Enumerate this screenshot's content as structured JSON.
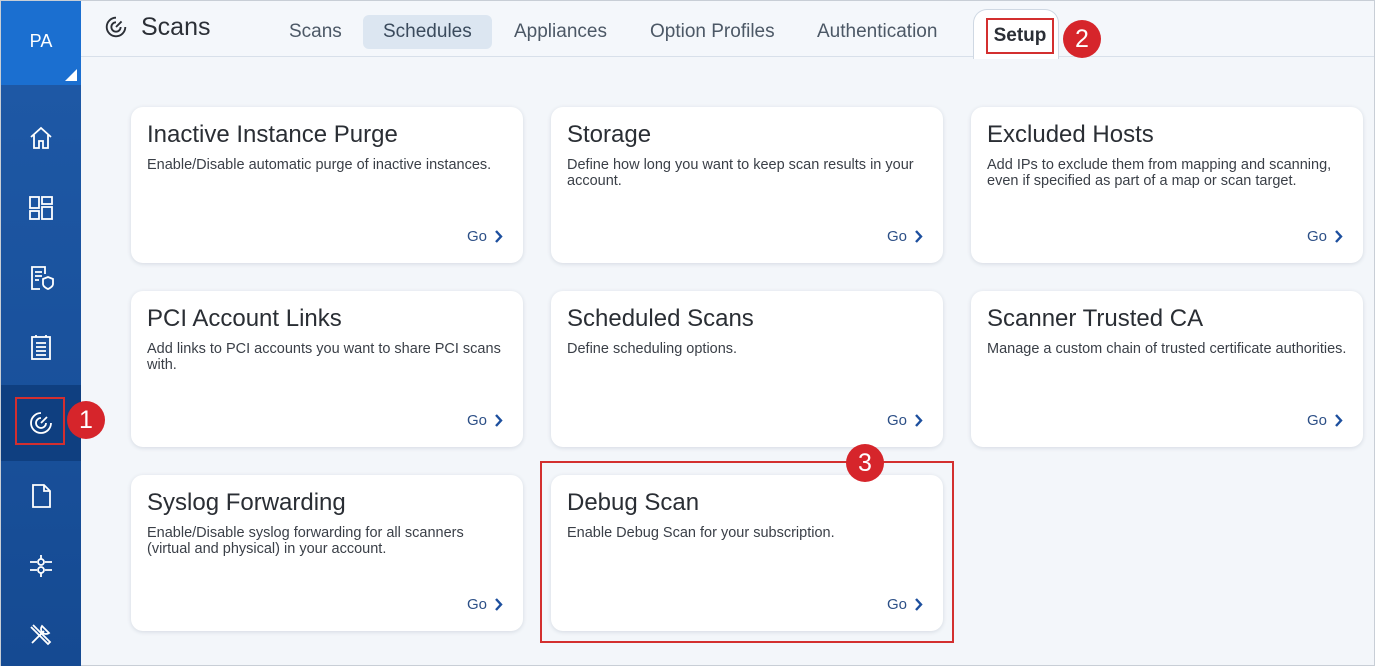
{
  "user": {
    "initials": "PA"
  },
  "header": {
    "app_title": "Scans",
    "tabs": [
      {
        "label": "Scans"
      },
      {
        "label": "Schedules"
      },
      {
        "label": "Appliances"
      },
      {
        "label": "Option Profiles"
      },
      {
        "label": "Authentication"
      },
      {
        "label": "Setup"
      }
    ]
  },
  "sidebar": {
    "items": [
      {
        "icon": "home-icon"
      },
      {
        "icon": "dashboard-icon"
      },
      {
        "icon": "report-shield-icon"
      },
      {
        "icon": "document-list-icon"
      },
      {
        "icon": "scans-radar-icon",
        "active": true
      },
      {
        "icon": "file-icon"
      },
      {
        "icon": "connector-icon"
      },
      {
        "icon": "tools-icon"
      }
    ]
  },
  "markers": {
    "m1": "1",
    "m2": "2",
    "m3": "3"
  },
  "cards": [
    {
      "title": "Inactive Instance Purge",
      "desc": "Enable/Disable automatic purge of inactive instances.",
      "go": "Go"
    },
    {
      "title": "Storage",
      "desc": "Define how long you want to keep scan results in your account.",
      "go": "Go"
    },
    {
      "title": "Excluded Hosts",
      "desc": "Add IPs to exclude them from mapping and scanning, even if specified as part of a map or scan target.",
      "go": "Go"
    },
    {
      "title": "PCI Account Links",
      "desc": "Add links to PCI accounts you want to share PCI scans with.",
      "go": "Go"
    },
    {
      "title": "Scheduled Scans",
      "desc": "Define scheduling options.",
      "go": "Go"
    },
    {
      "title": "Scanner Trusted CA",
      "desc": "Manage a custom chain of trusted certificate authorities.",
      "go": "Go"
    },
    {
      "title": "Syslog Forwarding",
      "desc": "Enable/Disable syslog forwarding for all scanners (virtual and physical) in your account.",
      "go": "Go"
    },
    {
      "title": "Debug Scan",
      "desc": "Enable Debug Scan for your subscription.",
      "go": "Go"
    }
  ],
  "colors": {
    "sidebar": "#1f5aa8",
    "avatar": "#1b6fd0",
    "accent_red": "#d6252b",
    "link": "#2c4f86"
  }
}
